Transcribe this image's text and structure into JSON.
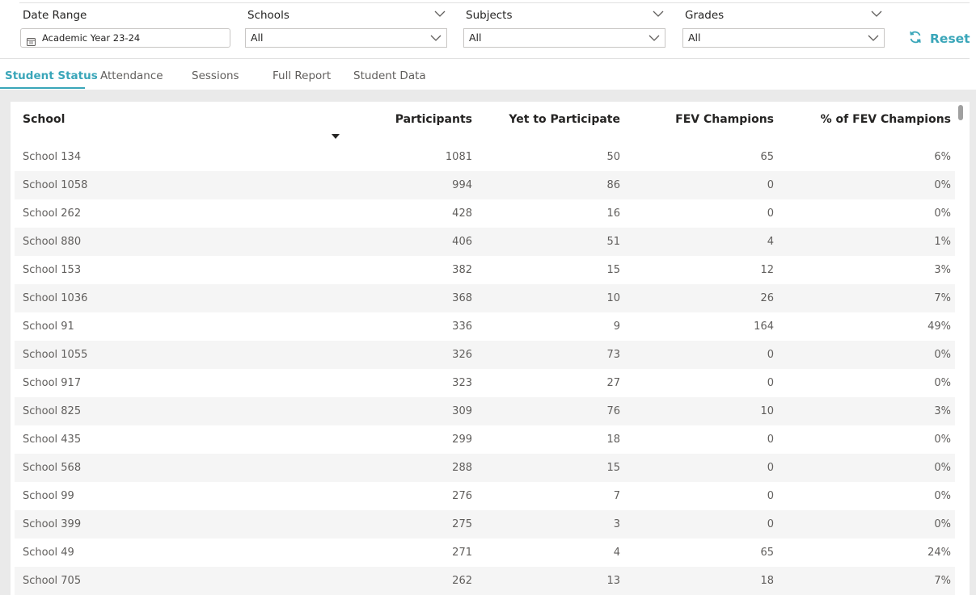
{
  "filters": {
    "date_range": {
      "label": "Date Range",
      "value": "Academic Year 23-24"
    },
    "schools": {
      "label": "Schools",
      "value": "All"
    },
    "subjects": {
      "label": "Subjects",
      "value": "All"
    },
    "grades": {
      "label": "Grades",
      "value": "All"
    },
    "reset_label": "Reset"
  },
  "tabs": [
    {
      "label": "Student Status",
      "active": true
    },
    {
      "label": "Attendance"
    },
    {
      "label": "Sessions"
    },
    {
      "label": "Full Report"
    },
    {
      "label": "Student Data"
    }
  ],
  "table": {
    "columns": [
      "School",
      "Participants",
      "Yet to Participate",
      "FEV Champions",
      "% of FEV Champions"
    ],
    "sort": {
      "column": "School",
      "direction": "descending"
    },
    "rows": [
      {
        "school": "School 134",
        "participants": "1081",
        "yet": "50",
        "fev": "65",
        "pct": "6%"
      },
      {
        "school": "School 1058",
        "participants": "994",
        "yet": "86",
        "fev": "0",
        "pct": "0%"
      },
      {
        "school": "School 262",
        "participants": "428",
        "yet": "16",
        "fev": "0",
        "pct": "0%"
      },
      {
        "school": "School 880",
        "participants": "406",
        "yet": "51",
        "fev": "4",
        "pct": "1%"
      },
      {
        "school": "School 153",
        "participants": "382",
        "yet": "15",
        "fev": "12",
        "pct": "3%"
      },
      {
        "school": "School 1036",
        "participants": "368",
        "yet": "10",
        "fev": "26",
        "pct": "7%"
      },
      {
        "school": "School 91",
        "participants": "336",
        "yet": "9",
        "fev": "164",
        "pct": "49%"
      },
      {
        "school": "School 1055",
        "participants": "326",
        "yet": "73",
        "fev": "0",
        "pct": "0%"
      },
      {
        "school": "School 917",
        "participants": "323",
        "yet": "27",
        "fev": "0",
        "pct": "0%"
      },
      {
        "school": "School 825",
        "participants": "309",
        "yet": "76",
        "fev": "10",
        "pct": "3%"
      },
      {
        "school": "School 435",
        "participants": "299",
        "yet": "18",
        "fev": "0",
        "pct": "0%"
      },
      {
        "school": "School 568",
        "participants": "288",
        "yet": "15",
        "fev": "0",
        "pct": "0%"
      },
      {
        "school": "School 99",
        "participants": "276",
        "yet": "7",
        "fev": "0",
        "pct": "0%"
      },
      {
        "school": "School 399",
        "participants": "275",
        "yet": "3",
        "fev": "0",
        "pct": "0%"
      },
      {
        "school": "School 49",
        "participants": "271",
        "yet": "4",
        "fev": "65",
        "pct": "24%"
      },
      {
        "school": "School 705",
        "participants": "262",
        "yet": "13",
        "fev": "18",
        "pct": "7%"
      }
    ]
  },
  "colors": {
    "accent": "#3aa6b9",
    "row_alt": "#f5f5f5",
    "page_bg": "#eaeaea"
  },
  "icons": {
    "calendar": "calendar-icon",
    "chevron": "chevron-down-icon",
    "reset": "refresh-icon",
    "sort": "sort-descending-icon"
  }
}
